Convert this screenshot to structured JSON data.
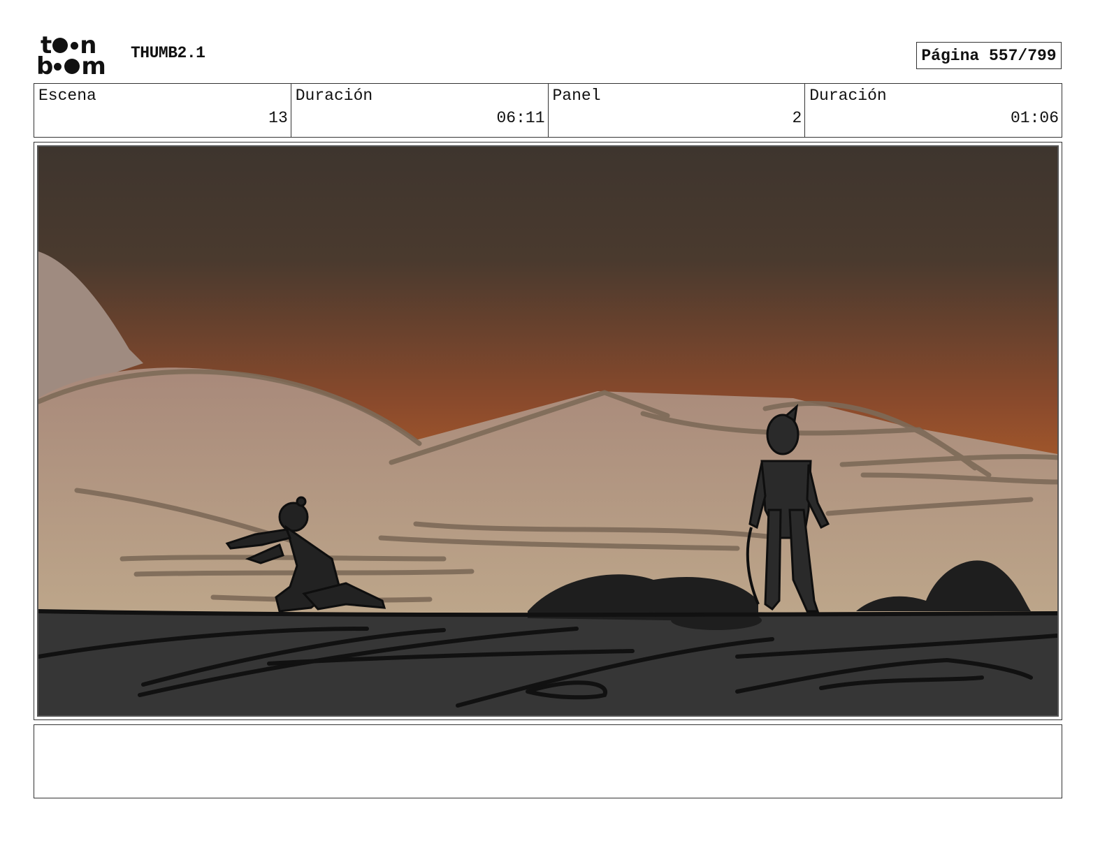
{
  "header": {
    "logo_top": "to●n",
    "logo_bottom": "b●●m",
    "title": "THUMB2.1",
    "page_label": "Página 557/799"
  },
  "info": {
    "scene_label": "Escena",
    "scene_value": "13",
    "scene_duration_label": "Duración",
    "scene_duration_value": "06:11",
    "panel_label": "Panel",
    "panel_value": "2",
    "panel_duration_label": "Duración",
    "panel_duration_value": "01:06"
  },
  "notes": {
    "text": ""
  },
  "colors": {
    "sky_top": "#3e352e",
    "sky_bottom": "#b05f2a",
    "dunes": "#b59a82",
    "ground": "#363636",
    "silhouette": "#1e1e1e"
  }
}
